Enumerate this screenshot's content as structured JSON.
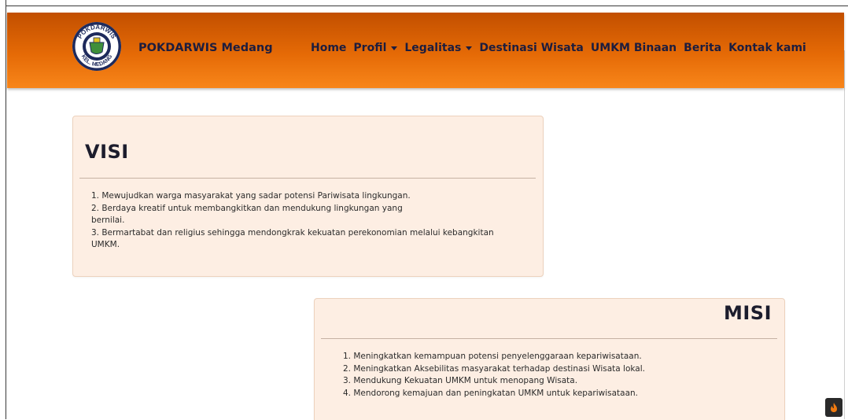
{
  "brand": {
    "name": "POKDARWIS Medang",
    "logo_text_top": "POKDARWIS",
    "logo_text_bottom": "KEL. MEDANG"
  },
  "nav": [
    {
      "label": "Home",
      "dropdown": false
    },
    {
      "label": "Profil",
      "dropdown": true
    },
    {
      "label": "Legalitas",
      "dropdown": true
    },
    {
      "label": "Destinasi Wisata",
      "dropdown": false
    },
    {
      "label": "UMKM Binaan",
      "dropdown": false
    },
    {
      "label": "Berita",
      "dropdown": false
    },
    {
      "label": "Kontak kami",
      "dropdown": false
    }
  ],
  "visi": {
    "title": "VISI",
    "lines": [
      "1. Mewujudkan warga masyarakat yang sadar potensi Pariwisata lingkungan.",
      "2. Berdaya kreatif untuk membangkitkan dan mendukung lingkungan yang",
      "bernilai.",
      "3. Bermartabat dan religius sehingga mendongkrak kekuatan perekonomian melalui kebangkitan",
      "UMKM."
    ]
  },
  "misi": {
    "title": "MISI",
    "lines": [
      "1. Meningkatkan kemampuan potensi penyelenggaraan kepariwisataan.",
      "2. Meningkatkan Aksebilitas masyarakat terhadap destinasi Wisata lokal.",
      "3. Mendukung Kekuatan UMKM untuk menopang Wisata.",
      "4. Mendorong kemajuan dan peningkatan UMKM untuk kepariwisataan."
    ]
  },
  "colors": {
    "navbar_top": "#c24f00",
    "navbar_bottom": "#f8861a",
    "card_bg": "#fdeee3",
    "text_dark": "#1d1d3e"
  },
  "icons": {
    "corner_button": "flame-icon"
  }
}
